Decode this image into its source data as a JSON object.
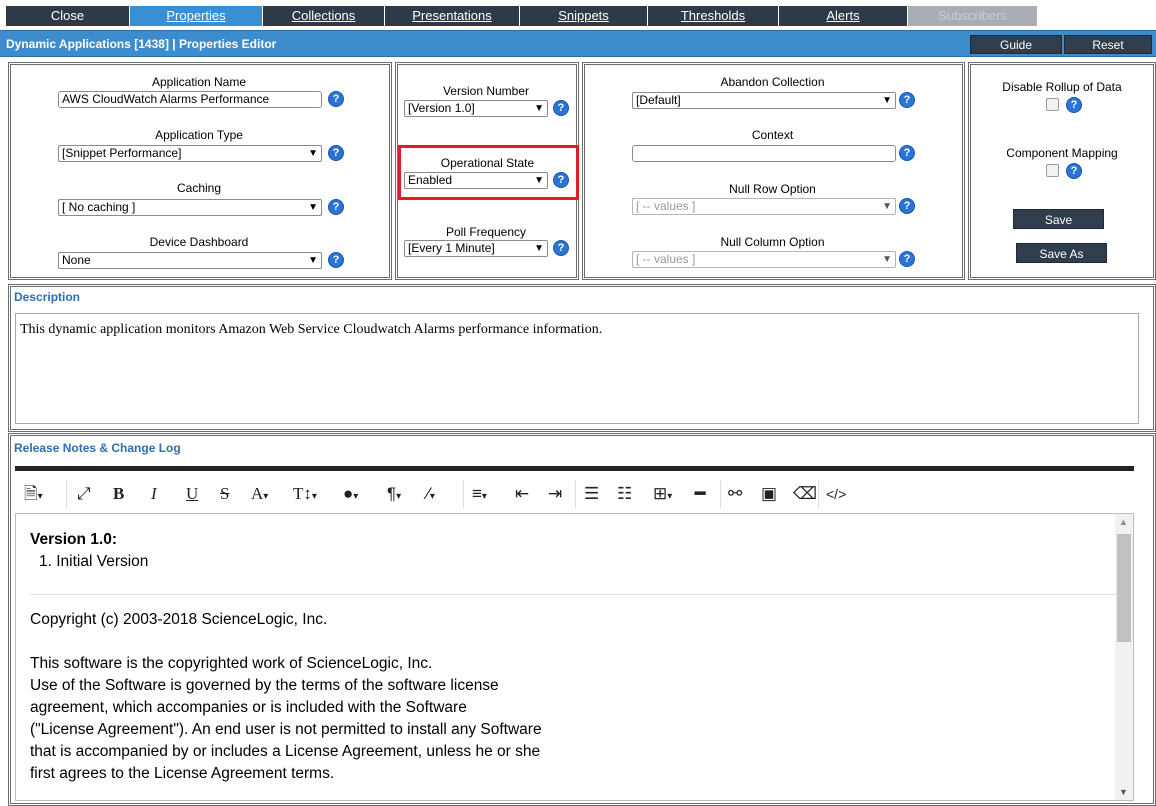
{
  "tabs": [
    {
      "label": "Close",
      "state": "normal"
    },
    {
      "label": "Properties",
      "state": "active"
    },
    {
      "label": "Collections",
      "state": "link"
    },
    {
      "label": "Presentations",
      "state": "link"
    },
    {
      "label": "Snippets",
      "state": "link"
    },
    {
      "label": "Thresholds",
      "state": "link"
    },
    {
      "label": "Alerts",
      "state": "link"
    },
    {
      "label": "Subscribers",
      "state": "disabled"
    }
  ],
  "titlebar": {
    "title": "Dynamic Applications [1438] | Properties Editor",
    "guide_label": "Guide",
    "reset_label": "Reset"
  },
  "properties": {
    "app_name_label": "Application Name",
    "app_name_value": "AWS CloudWatch Alarms Performance",
    "app_type_label": "Application Type",
    "app_type_value": "[Snippet Performance]",
    "caching_label": "Caching",
    "caching_value": "[ No caching ]",
    "dashboard_label": "Device Dashboard",
    "dashboard_value": "None",
    "version_label": "Version Number",
    "version_value": "[Version 1.0]",
    "op_state_label": "Operational State",
    "op_state_value": "Enabled",
    "poll_label": "Poll Frequency",
    "poll_value": "[Every 1 Minute]",
    "abandon_label": "Abandon Collection",
    "abandon_value": "[Default]",
    "context_label": "Context",
    "context_value": "",
    "null_row_label": "Null Row Option",
    "null_row_value": "[ -- values ]",
    "null_col_label": "Null Column Option",
    "null_col_value": "[ -- values ]",
    "rollup_label": "Disable Rollup of Data",
    "component_label": "Component Mapping",
    "save_label": "Save",
    "save_as_label": "Save As"
  },
  "description": {
    "heading": "Description",
    "text": "This dynamic application monitors Amazon Web Service Cloudwatch Alarms performance information."
  },
  "release_notes": {
    "heading": "Release Notes & Change Log",
    "version_heading": "Version 1.0:",
    "version_item": "1. Initial Version",
    "copyright": "Copyright (c) 2003-2018 ScienceLogic, Inc.",
    "license_lines": [
      "This software is the copyrighted work of ScienceLogic, Inc.",
      "Use of the Software is governed by the terms of the software license",
      "agreement, which accompanies or is included with the Software",
      "(\"License Agreement\"). An end user is not permitted to install any Software",
      "that is accompanied by or includes a License Agreement, unless he or she",
      "first agrees to the License Agreement terms."
    ]
  },
  "highlight_color": "#e11c24",
  "accent_color": "#3d8ccd"
}
